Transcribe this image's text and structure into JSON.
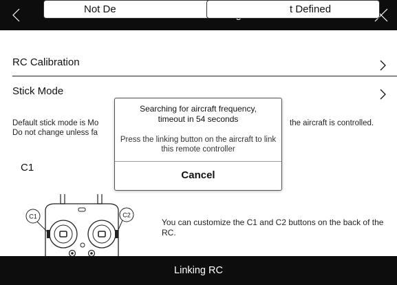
{
  "header": {
    "title": "RC Control Setting",
    "back_icon": "chevron-left-icon",
    "close_icon": "close-icon"
  },
  "rows": {
    "calibration": {
      "label": "RC Calibration",
      "icon": "chevron-right-icon"
    },
    "stick_mode": {
      "label": "Stick Mode",
      "icon": "chevron-right-icon"
    }
  },
  "description": {
    "line1_left": "Default stick mode is Mo",
    "line1_right": "the aircraft is controlled.",
    "line2_left": "Do not change unless fa"
  },
  "custom_buttons": {
    "c1_label": "C1",
    "c1_value": "Not De",
    "c2_value": "t Defined"
  },
  "rc_diagram": {
    "c1_tag": "C1",
    "c2_tag": "C2"
  },
  "hint": "You can customize the C1 and C2 buttons on the back of the RC.",
  "dialog": {
    "title": "Searching for aircraft frequency, timeout in 54 seconds",
    "message": "Press the linking button on the aircraft to link this remote controller",
    "cancel_label": "Cancel"
  },
  "bottom_bar": {
    "label": "Linking RC"
  },
  "colors": {
    "bar_background": "#0d0d0d",
    "bar_text": "#ffffff",
    "page_background": "#ffffff"
  }
}
